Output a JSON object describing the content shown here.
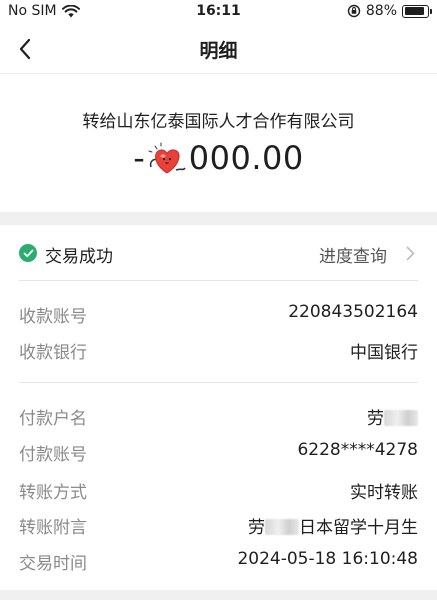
{
  "status_bar": {
    "carrier": "No SIM",
    "time": "16:11",
    "battery_text": "88%",
    "battery_level": 0.88,
    "icons": [
      "wifi-icon",
      "orientation-lock-icon",
      "battery-icon"
    ]
  },
  "nav": {
    "title": "明细",
    "back_icon": "chevron-left-icon"
  },
  "transfer": {
    "payee": "转给山东亿泰国际人才合作有限公司",
    "amount_prefix": "-",
    "amount": "000.00",
    "sticker_icon": "heart-sticker-icon"
  },
  "status": {
    "label": "交易成功",
    "link": "进度查询",
    "color": "#2bad6f"
  },
  "details": {
    "account_label": "收款账号",
    "account_value": "220843502164",
    "bank_label": "收款银行",
    "bank_value": "中国银行",
    "payer_name_label": "付款户名",
    "payer_name_value": "劳",
    "payer_account_label": "付款账号",
    "payer_account_value": "6228****4278",
    "method_label": "转账方式",
    "method_value": "实时转账",
    "memo_label": "转账附言",
    "memo_prefix": "劳",
    "memo_suffix": "日本留学十月生",
    "time_label": "交易时间",
    "time_value": "2024-05-18 16:10:48"
  }
}
